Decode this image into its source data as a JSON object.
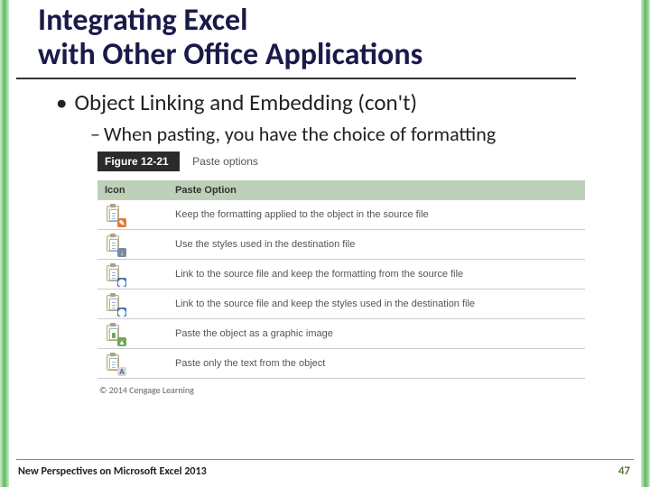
{
  "title_line1": "Integrating Excel",
  "title_line2": "with Other Office Applications",
  "bullet1": "Object Linking and Embedding (con't)",
  "bullet2": "When pasting, you have the choice of formatting",
  "figure": {
    "label": "Figure 12-21",
    "caption": "Paste options",
    "header_icon": "Icon",
    "header_option": "Paste Option",
    "rows": [
      {
        "badge": "✎",
        "class": "brush",
        "text": "Keep the formatting applied to the object in the source file"
      },
      {
        "badge": "↓",
        "class": "style",
        "text": "Use the styles used in the destination file"
      },
      {
        "badge": "⬤",
        "class": "link",
        "text": "Link to the source file and keep the formatting from the source file"
      },
      {
        "badge": "⬤",
        "class": "link2",
        "text": "Link to the source file and keep the styles used in the destination file"
      },
      {
        "badge": "▲",
        "class": "pic",
        "text": "Paste the object as a graphic image"
      },
      {
        "badge": "A",
        "class": "text",
        "text": "Paste only the text from the object"
      }
    ],
    "copyright": "© 2014 Cengage Learning"
  },
  "footer_left": "New Perspectives on Microsoft Excel 2013",
  "footer_right": "47"
}
